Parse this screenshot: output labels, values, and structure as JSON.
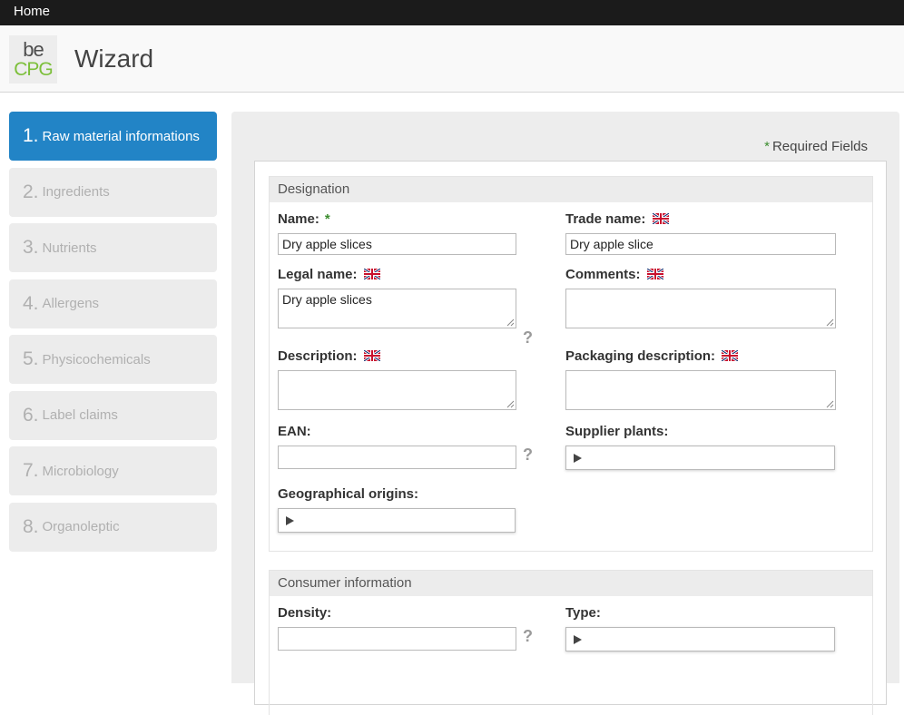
{
  "topbar": {
    "home_label": "Home"
  },
  "header": {
    "logo_top": "be",
    "logo_bottom": "CPG",
    "title": "Wizard"
  },
  "steps": [
    {
      "num": "1.",
      "label": "Raw material informations",
      "active": true
    },
    {
      "num": "2.",
      "label": "Ingredients",
      "active": false
    },
    {
      "num": "3.",
      "label": "Nutrients",
      "active": false
    },
    {
      "num": "4.",
      "label": "Allergens",
      "active": false
    },
    {
      "num": "5.",
      "label": "Physicochemicals",
      "active": false
    },
    {
      "num": "6.",
      "label": "Label claims",
      "active": false
    },
    {
      "num": "7.",
      "label": "Microbiology",
      "active": false
    },
    {
      "num": "8.",
      "label": "Organoleptic",
      "active": false
    }
  ],
  "form": {
    "required_star": "*",
    "required_note": "Required Fields",
    "designation": {
      "legend": "Designation",
      "name": {
        "label": "Name:",
        "value": "Dry apple slices"
      },
      "trade_name": {
        "label": "Trade name:",
        "value": "Dry apple slice"
      },
      "legal_name": {
        "label": "Legal name:",
        "value": "Dry apple slices"
      },
      "comments": {
        "label": "Comments:",
        "value": ""
      },
      "description": {
        "label": "Description:",
        "value": ""
      },
      "packaging_description": {
        "label": "Packaging description:",
        "value": ""
      },
      "ean": {
        "label": "EAN:",
        "value": ""
      },
      "supplier_plants": {
        "label": "Supplier plants:"
      },
      "geographical_origins": {
        "label": "Geographical origins:"
      }
    },
    "consumer_information": {
      "legend": "Consumer information",
      "density": {
        "label": "Density:",
        "value": ""
      },
      "type": {
        "label": "Type:"
      }
    },
    "help_glyph": "?"
  },
  "icons": {
    "flag": "uk-flag-icon",
    "picker": "triangle-right-icon",
    "resize": "resize-grip-icon"
  },
  "colors": {
    "active_step": "#2284c6",
    "topbar": "#1b1b1b",
    "required": "#3c8d2f",
    "logo_green": "#7cbf3a"
  }
}
